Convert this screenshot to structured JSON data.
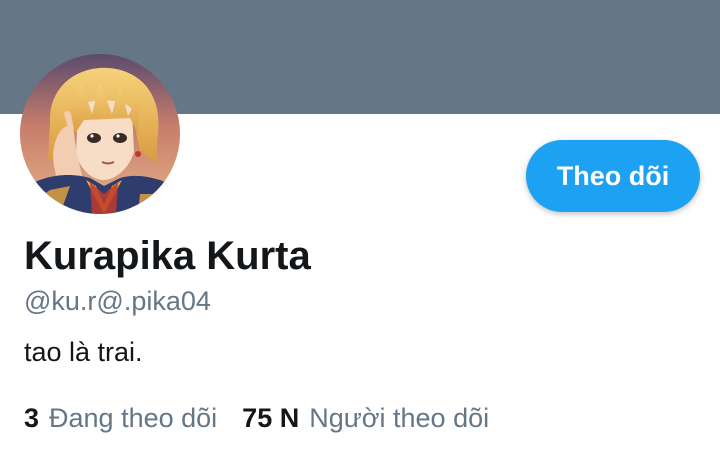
{
  "colors": {
    "banner": "#657786",
    "accent": "#1da1f2",
    "primary_text": "#14171a",
    "secondary_text": "#657786",
    "background": "#ffffff"
  },
  "profile": {
    "display_name": "Kurapika Kurta",
    "handle": "@ku.r@.pika04",
    "bio": "tao là trai.",
    "follow_button_label": "Theo dõi"
  },
  "stats": {
    "following_count": "3",
    "following_label": "Đang theo dõi",
    "followers_count": "75 N",
    "followers_label": "Người theo dõi"
  },
  "icons": {
    "avatar": "anime-character-avatar"
  }
}
